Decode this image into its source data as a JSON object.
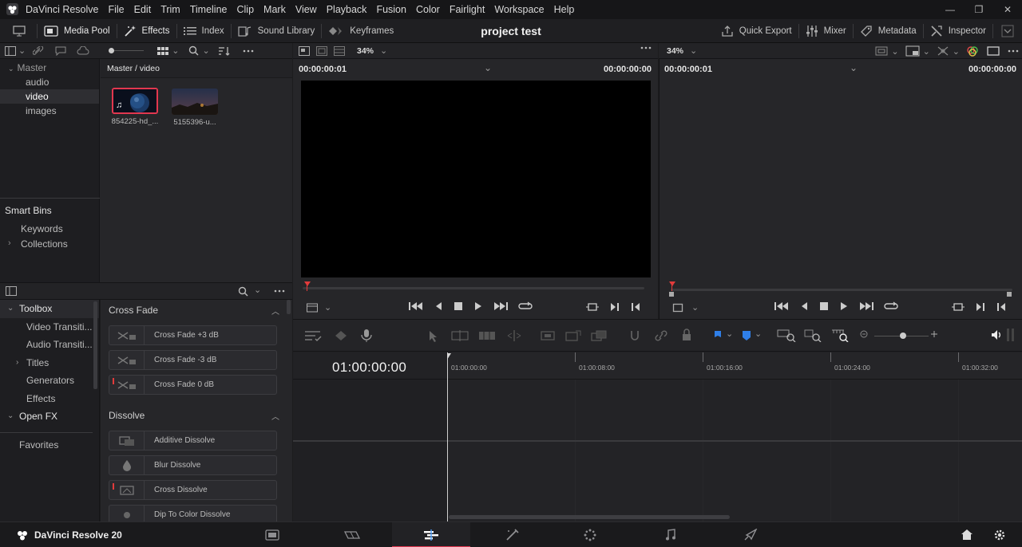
{
  "app": {
    "title": "DaVinci Resolve",
    "menu": [
      "File",
      "Edit",
      "Trim",
      "Timeline",
      "Clip",
      "Mark",
      "View",
      "Playback",
      "Fusion",
      "Color",
      "Fairlight",
      "Workspace",
      "Help"
    ]
  },
  "toolbar": {
    "media_pool": "Media Pool",
    "effects": "Effects",
    "index": "Index",
    "sound_library": "Sound Library",
    "keyframes": "Keyframes",
    "project_title": "project test",
    "quick_export": "Quick Export",
    "mixer": "Mixer",
    "metadata": "Metadata",
    "inspector": "Inspector"
  },
  "media_pool": {
    "zoom": "34%",
    "path": "Master / video",
    "bins": {
      "master": "Master",
      "items": [
        "audio",
        "video",
        "images"
      ],
      "selected": "video"
    },
    "smart_bins": {
      "title": "Smart Bins",
      "items": [
        "Keywords",
        "Collections"
      ]
    },
    "clips": [
      {
        "name": "854225-hd_..."
      },
      {
        "name": "5155396-u..."
      }
    ]
  },
  "source_viewer": {
    "zoom": "34%",
    "timecode_left": "00:00:00:01",
    "timecode_right": "00:00:00:00"
  },
  "timeline_viewer": {
    "timecode_left": "00:00:00:01",
    "timecode_right": "00:00:00:00"
  },
  "toolbox": {
    "items": [
      {
        "label": "Toolbox",
        "level": 0
      },
      {
        "label": "Video Transiti...",
        "level": 1
      },
      {
        "label": "Audio Transiti...",
        "level": 1
      },
      {
        "label": "Titles",
        "level": 1
      },
      {
        "label": "Generators",
        "level": 1
      },
      {
        "label": "Effects",
        "level": 1
      },
      {
        "label": "Open FX",
        "level": 0
      }
    ],
    "favorites": "Favorites"
  },
  "effects_list": {
    "cross_fade": {
      "title": "Cross Fade",
      "items": [
        "Cross Fade +3 dB",
        "Cross Fade -3 dB",
        "Cross Fade 0 dB"
      ]
    },
    "dissolve": {
      "title": "Dissolve",
      "items": [
        "Additive Dissolve",
        "Blur Dissolve",
        "Cross Dissolve",
        "Dip To Color Dissolve"
      ]
    }
  },
  "timeline": {
    "timecode": "01:00:00:00",
    "ruler": [
      "01:00:00:00",
      "01:00:08:00",
      "01:00:16:00",
      "01:00:24:00",
      "01:00:32:00"
    ]
  },
  "footer": {
    "brand": "DaVinci Resolve 20"
  },
  "colors": {
    "accent_red": "#e2374f",
    "flag_blue": "#2f7fe8",
    "background": "#1c1c1e"
  }
}
